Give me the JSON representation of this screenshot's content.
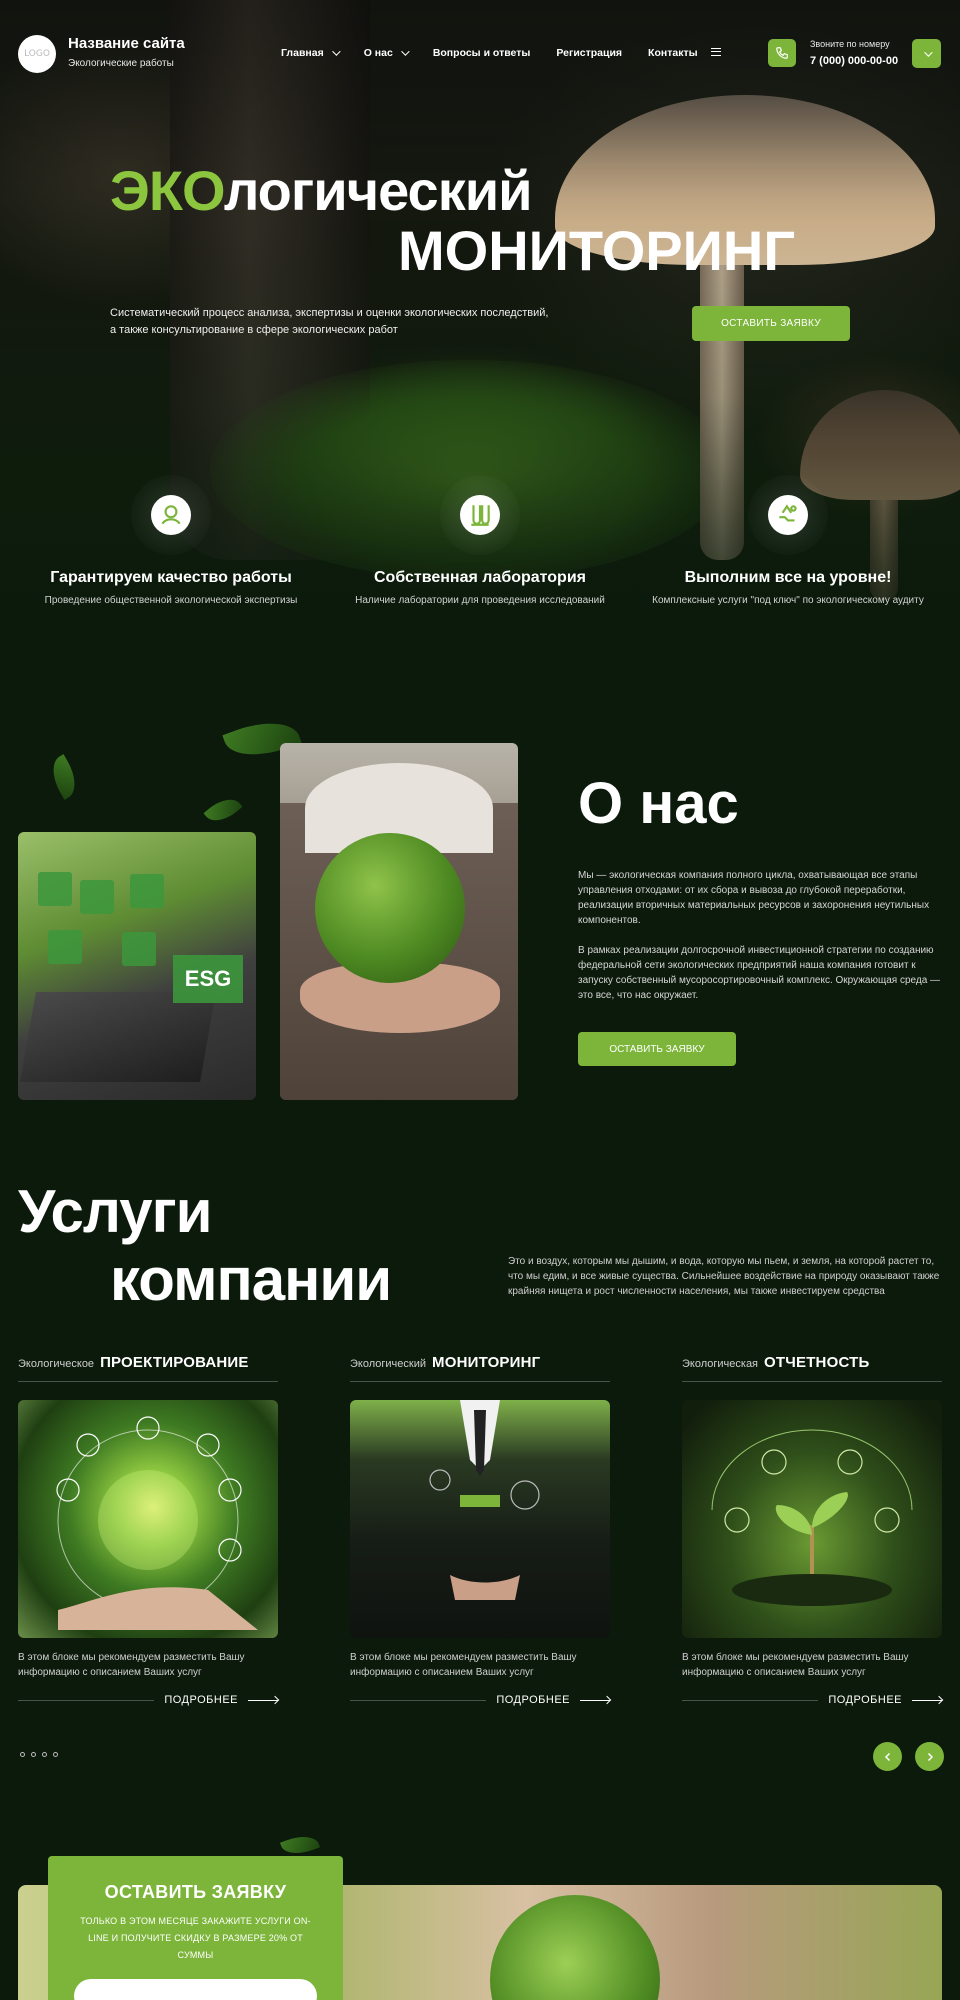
{
  "header": {
    "logo_text": "LOGO",
    "site_title": "Название сайта",
    "site_subtitle": "Экологические работы",
    "nav": [
      {
        "label": "Главная",
        "has_dropdown": true
      },
      {
        "label": "О нас",
        "has_dropdown": true
      },
      {
        "label": "Вопросы и ответы",
        "has_dropdown": false
      },
      {
        "label": "Регистрация",
        "has_dropdown": false
      },
      {
        "label": "Контакты",
        "has_dropdown": false
      }
    ],
    "phone_label": "Звоните по номеру",
    "phone_number": "7 (000) 000-00-00"
  },
  "hero": {
    "title_accent": "ЭКО",
    "title_rest": "логический",
    "title_line2": "МОНИТОРИНГ",
    "description": "Систематический процесс анализа, экспертизы и оценки экологических последствий, а также консультирование в сфере экологических работ",
    "button_label": "ОСТАВИТЬ ЗАЯВКУ"
  },
  "features": [
    {
      "title": "Гарантируем качество работы",
      "text": "Проведение общественной экологической экспертизы",
      "icon": "quality-icon"
    },
    {
      "title": "Собственная лаборатория",
      "text": "Наличие лаборатории для проведения исследований",
      "icon": "lab-icon"
    },
    {
      "title": "Выполним все на уровне!",
      "text": "Комплексные услуги \"под ключ\" по экологическому аудиту",
      "icon": "service-icon"
    }
  ],
  "about": {
    "title": "О нас",
    "esg_label": "ESG",
    "paragraph1": "Мы — экологическая компания полного цикла, охватывающая все этапы управления отходами: от их сбора и вывоза до глубокой переработки, реализации вторичных материальных ресурсов и захоронения неутильных компонентов.",
    "paragraph2": "В рамках реализации долгосрочной инвестиционной стратегии по созданию федеральной сети экологических предприятий наша компания готовит к запуску собственный мусоросортировочный комплекс. Окружающая среда — это все, что нас окружает.",
    "button_label": "ОСТАВИТЬ ЗАЯВКУ"
  },
  "services": {
    "title_line1": "Услуги",
    "title_line2": "компании",
    "description": "Это и воздух, которым мы дышим, и вода, которую мы пьем, и земля, на которой растет то, что мы едим, и все живые существа. Сильнейшее воздействие на природу оказывают также крайняя нищета и рост численности населения, мы также инвестируем средства",
    "cards": [
      {
        "prefix": "Экологическое",
        "title": "ПРОЕКТИРОВАНИЕ",
        "text": "В этом блоке мы рекомендуем разместить Вашу информацию с описанием Ваших услуг",
        "more": "ПОДРОБНЕЕ"
      },
      {
        "prefix": "Экологический",
        "title": "МОНИТОРИНГ",
        "text": "В этом блоке мы рекомендуем разместить Вашу информацию с описанием Ваших услуг",
        "more": "ПОДРОБНЕЕ"
      },
      {
        "prefix": "Экологическая",
        "title": "ОТЧЕТНОСТЬ",
        "text": "В этом блоке мы рекомендуем разместить Вашу информацию с описанием Ваших услуг",
        "more": "ПОДРОБНЕЕ"
      }
    ],
    "slider_dots": 4
  },
  "cta": {
    "title": "ОСТАВИТЬ ЗАЯВКУ",
    "text": "ТОЛЬКО В ЭТОМ МЕСЯЦЕ ЗАКАЖИТЕ УСЛУГИ ON-LINE И ПОЛУЧИТЕ СКИДКУ В РАЗМЕРЕ 20% ОТ СУММЫ"
  },
  "colors": {
    "accent": "#7cb53a",
    "accent_text": "#8cc63f",
    "background": "#0c1a0c"
  }
}
